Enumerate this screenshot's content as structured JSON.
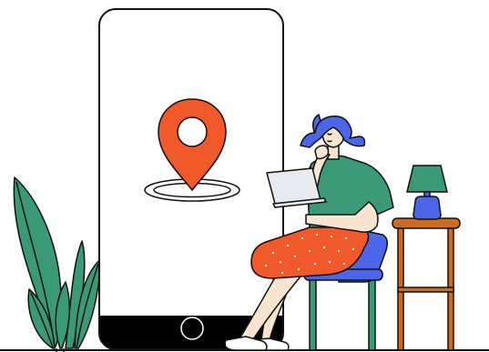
{
  "illustration": {
    "subject": "location-services",
    "colors": {
      "outline": "#111111",
      "phone_screen": "#ffffff",
      "phone_bottom_bar": "#000000",
      "pin": "#f2592a",
      "plant": "#3a9a78",
      "hair": "#4b66e8",
      "shirt": "#3a9a78",
      "skin": "#f7e5cf",
      "skirt": "#f2592a",
      "chair": "#4b66e8",
      "chair_legs": "#3a9a78",
      "laptop": "#e9eaf0",
      "lamp_shade": "#3a9a78",
      "lamp_base": "#4b66e8",
      "table": "#d06b1e",
      "floor": "#111111"
    },
    "icons": [
      "location-pin-icon",
      "home-button-icon"
    ]
  }
}
